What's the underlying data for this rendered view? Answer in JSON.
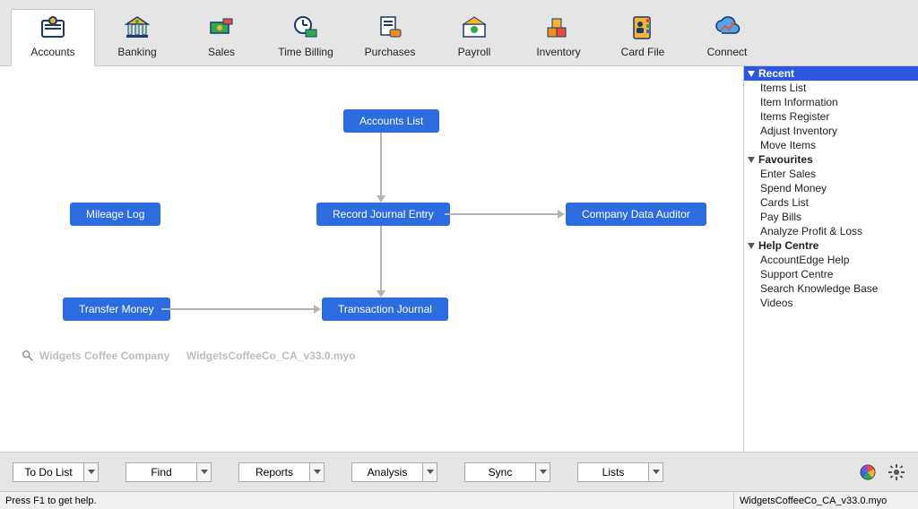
{
  "tabs": [
    {
      "label": "Accounts"
    },
    {
      "label": "Banking"
    },
    {
      "label": "Sales"
    },
    {
      "label": "Time Billing"
    },
    {
      "label": "Purchases"
    },
    {
      "label": "Payroll"
    },
    {
      "label": "Inventory"
    },
    {
      "label": "Card File"
    },
    {
      "label": "Connect"
    }
  ],
  "nodes": {
    "accounts_list": "Accounts List",
    "mileage_log": "Mileage Log",
    "record_journal": "Record Journal Entry",
    "company_auditor": "Company Data Auditor",
    "transfer_money": "Transfer Money",
    "transaction_journal": "Transaction Journal"
  },
  "company": {
    "name": "Widgets Coffee Company",
    "file": "WidgetsCoffeeCo_CA_v33.0.myo"
  },
  "side": {
    "sections": [
      {
        "title": "Recent",
        "selected": true,
        "items": [
          "Items List",
          "Item Information",
          "Items Register",
          "Adjust Inventory",
          "Move Items"
        ]
      },
      {
        "title": "Favourites",
        "selected": false,
        "items": [
          "Enter Sales",
          "Spend Money",
          "Cards List",
          "Pay Bills",
          "Analyze Profit & Loss"
        ]
      },
      {
        "title": "Help Centre",
        "selected": false,
        "items": [
          "AccountEdge Help",
          "Support Centre",
          "Search Knowledge Base",
          "Videos"
        ]
      }
    ]
  },
  "bottom_combos": [
    "To Do List",
    "Find",
    "Reports",
    "Analysis",
    "Sync",
    "Lists"
  ],
  "status": {
    "help": "Press F1 to get help.",
    "file": "WidgetsCoffeeCo_CA_v33.0.myo"
  }
}
